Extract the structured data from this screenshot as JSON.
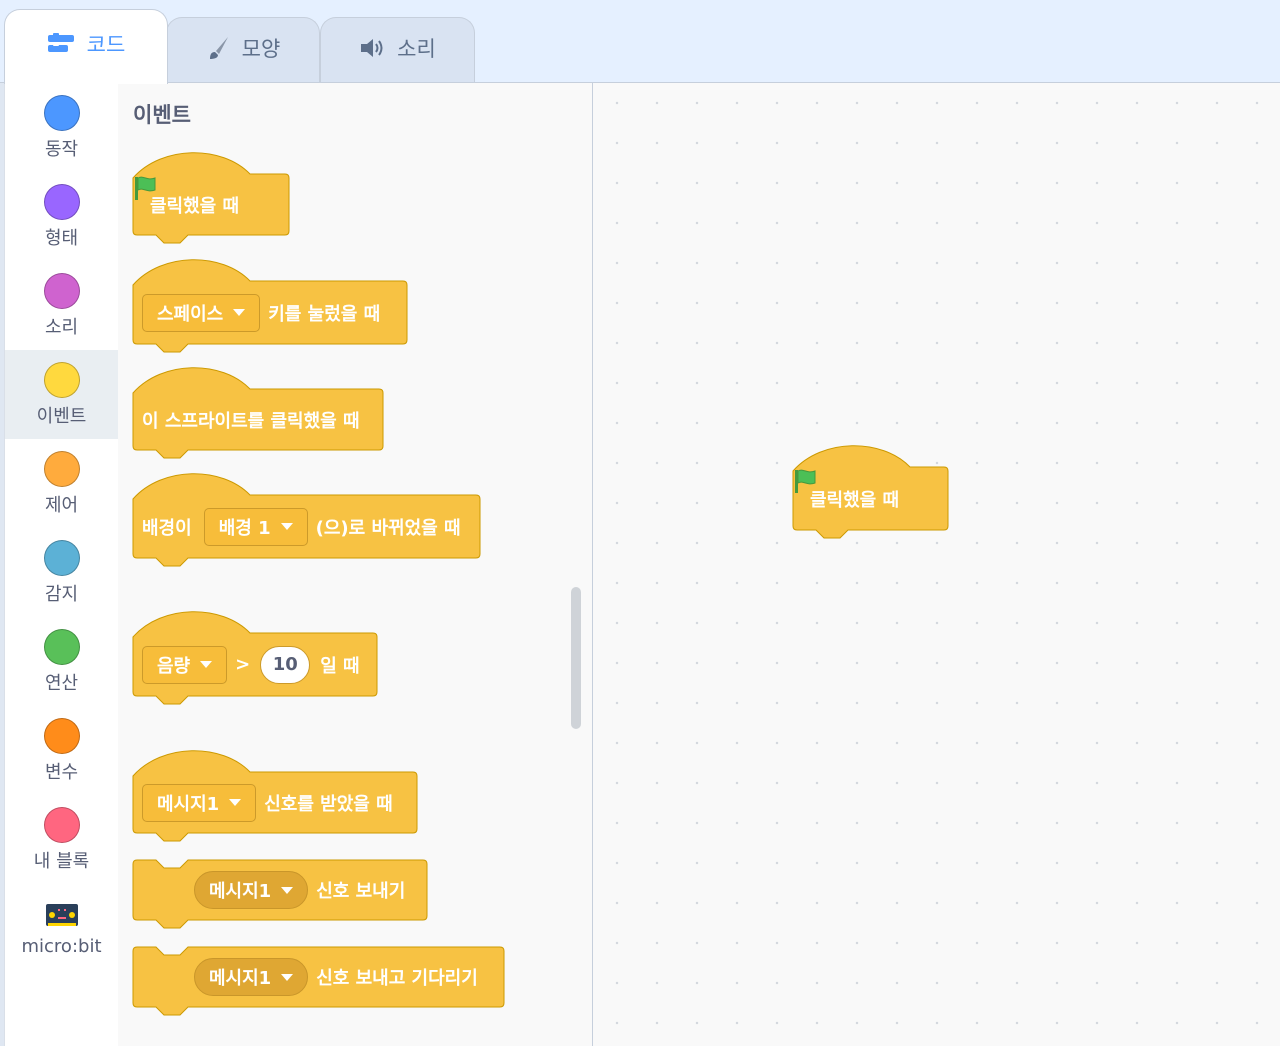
{
  "tabs": [
    {
      "label": "코드",
      "icon": "code-icon",
      "active": true
    },
    {
      "label": "모양",
      "icon": "brush-icon",
      "active": false
    },
    {
      "label": "소리",
      "icon": "speaker-icon",
      "active": false
    }
  ],
  "categories": [
    {
      "label": "동작",
      "color": "#4c97ff"
    },
    {
      "label": "형태",
      "color": "#9966ff"
    },
    {
      "label": "소리",
      "color": "#cf63cf"
    },
    {
      "label": "이벤트",
      "color": "#ffd500",
      "selected": true
    },
    {
      "label": "제어",
      "color": "#ffab19"
    },
    {
      "label": "감지",
      "color": "#5cb1d6"
    },
    {
      "label": "연산",
      "color": "#59c059"
    },
    {
      "label": "변수",
      "color": "#ff8c1a"
    },
    {
      "label": "내 블록",
      "color": "#ff6680"
    },
    {
      "label": "micro:bit",
      "icon": "microbit-icon"
    }
  ],
  "palette": {
    "title": "이벤트",
    "blocks": {
      "flag_clicked": {
        "text": "클릭했을 때"
      },
      "key_pressed": {
        "dropdown": "스페이스",
        "text": "키를 눌렀을 때"
      },
      "sprite_clicked": {
        "text": "이 스프라이트를 클릭했을 때"
      },
      "backdrop_switch": {
        "prefix": "배경이",
        "dropdown": "배경 1",
        "text": "(으)로 바뀌었을 때"
      },
      "greater_than": {
        "dropdown": "음량",
        "operator": ">",
        "value": "10",
        "text": "일 때"
      },
      "receive": {
        "dropdown": "메시지1",
        "text": "신호를 받았을 때"
      },
      "broadcast": {
        "dropdown": "메시지1",
        "text": "신호 보내기"
      },
      "broadcast_wait": {
        "dropdown": "메시지1",
        "text": "신호 보내고 기다리기"
      }
    }
  },
  "workspace": {
    "script_block": {
      "text": "클릭했을 때"
    }
  },
  "colors": {
    "event_block": "#ffbf00",
    "event_block_fill": "#f7c243",
    "event_block_border": "#cc9900",
    "flag": "#4cbf56",
    "accent": "#4c97ff"
  }
}
